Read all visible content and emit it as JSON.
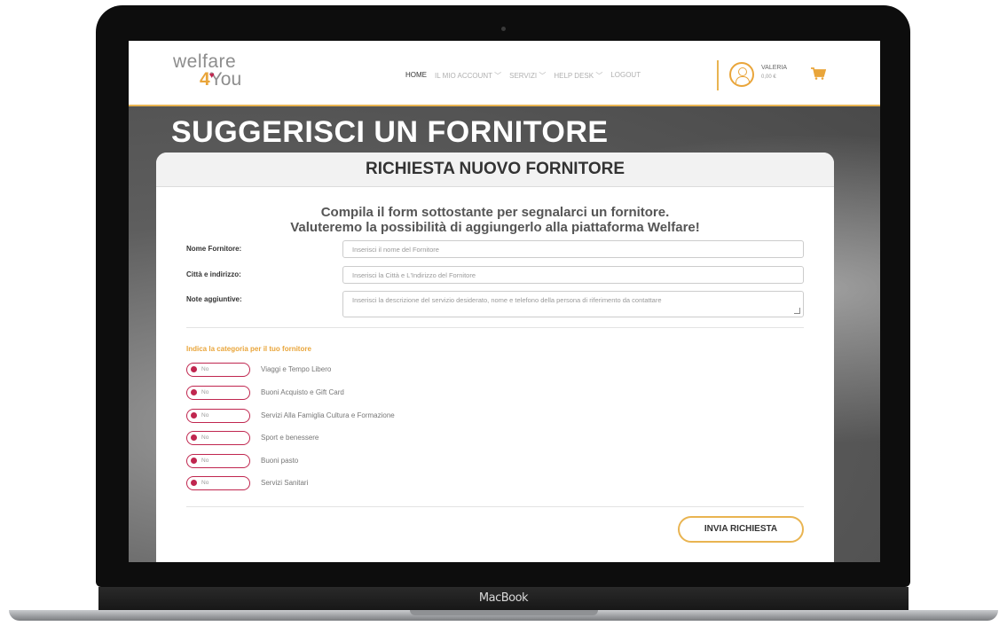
{
  "device": {
    "brand": "MacBook"
  },
  "header": {
    "logo": {
      "line1": "welfare",
      "line2_num": "4",
      "line2_text": "ou"
    },
    "nav": [
      "HOME",
      "IL MIO ACCOUNT ﹀",
      "SERVIZI ﹀",
      "HELP DESK ﹀",
      "LOGOUT"
    ],
    "user": {
      "name": "VALERIA",
      "credit": "0,00 €"
    }
  },
  "page": {
    "title": "SUGGERISCI UN FORNITORE"
  },
  "form": {
    "heading": "RICHIESTA NUOVO FORNITORE",
    "intro_line1": "Compila il form sottostante per segnalarci un fornitore.",
    "intro_line2": "Valuteremo la possibilità di aggiungerlo alla piattaforma Welfare!",
    "fields": [
      {
        "label": "Nome Fornitore:",
        "placeholder": "Inserisci il nome del Fornitore"
      },
      {
        "label": "Città e indirizzo:",
        "placeholder": "Inserisci la Città e L'Indirizzo del Fornitore"
      },
      {
        "label": "Note aggiuntive:",
        "placeholder": "Inserisci la descrizione del servizio desiderato, nome e telefono della persona di riferimento da contattare"
      }
    ],
    "category_title": "Indica la categoria per il tuo fornitore",
    "categories": [
      {
        "toggle": "No",
        "label": "Viaggi e Tempo Libero"
      },
      {
        "toggle": "No",
        "label": "Buoni Acquisto e Gift Card"
      },
      {
        "toggle": "No",
        "label": "Servizi Alla Famiglia Cultura e Formazione"
      },
      {
        "toggle": "No",
        "label": "Sport e benessere"
      },
      {
        "toggle": "No",
        "label": "Buoni pasto"
      },
      {
        "toggle": "No",
        "label": "Servizi Sanitari"
      }
    ],
    "submit_label": "INVIA RICHIESTA"
  },
  "colors": {
    "accent": "#e9b451",
    "toggle": "#c0264f",
    "title": "#ffffff"
  }
}
